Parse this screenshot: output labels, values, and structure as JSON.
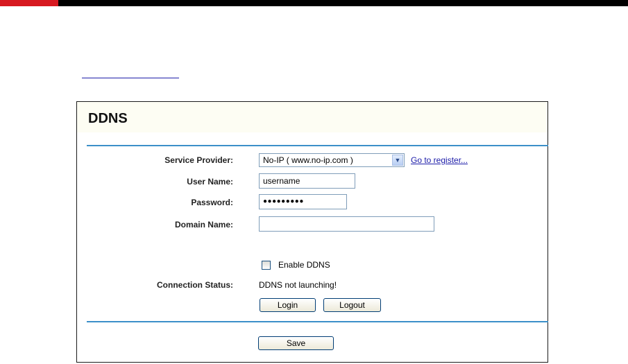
{
  "ddns": {
    "title": "DDNS",
    "service_provider": {
      "label": "Service Provider:",
      "selected": "No-IP ( www.no-ip.com )",
      "register_link": "Go to register..."
    },
    "user_name": {
      "label": "User Name:",
      "value": "username"
    },
    "password": {
      "label": "Password:",
      "value": "●●●●●●●●●"
    },
    "domain_name": {
      "label": "Domain Name:",
      "value": ""
    },
    "enable_ddns": {
      "label": "Enable DDNS",
      "checked": false
    },
    "connection_status": {
      "label": "Connection Status:",
      "value": "DDNS not launching!"
    },
    "buttons": {
      "login": "Login",
      "logout": "Logout",
      "save": "Save"
    }
  },
  "colors": {
    "accent_red": "#d71920",
    "rule_blue": "#3b8fc9",
    "link_blue": "#1a1aa8"
  }
}
